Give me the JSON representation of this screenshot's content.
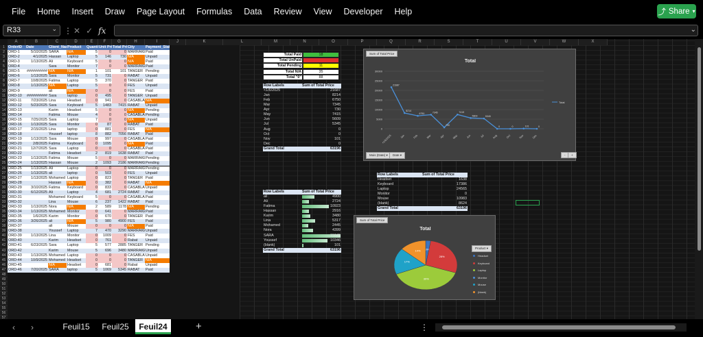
{
  "menu": [
    "File",
    "Home",
    "Insert",
    "Draw",
    "Page Layout",
    "Formulas",
    "Data",
    "Review",
    "View",
    "Developer",
    "Help"
  ],
  "share_label": "Share",
  "namebox": "R33",
  "columns": [
    "A",
    "B",
    "C",
    "D",
    "E",
    "F",
    "G",
    "H",
    "I",
    "J",
    "K",
    "L",
    "M",
    "N",
    "O",
    "P",
    "Q",
    "R",
    "S",
    "T",
    "U",
    "V",
    "W",
    "X"
  ],
  "headers": [
    "OrderID",
    "Date",
    "Client_Name",
    "Product",
    "Quantity",
    "Unit Price",
    "Total Price",
    "City",
    "Payment_Status"
  ],
  "rows": [
    [
      "ORD-1",
      "5/10/2025",
      "SARA",
      "N/A",
      "5",
      "0",
      "0",
      "MARRAKECH",
      "Paid"
    ],
    [
      "ORD-2",
      "4/1/2025",
      "Hassan",
      "Laptop",
      "5",
      "146",
      "730",
      "N/A",
      "Unpaid"
    ],
    [
      "ORD-3",
      "1/13/2025",
      "Ali",
      "Keyboard",
      "5",
      "0",
      "0",
      "N/A",
      "Paid"
    ],
    [
      "ORD-4",
      "",
      "Sara",
      "Monitor",
      "7",
      "0",
      "0",
      "MARRAKECH",
      "Paid"
    ],
    [
      "ORD-5",
      "##########",
      "N/A",
      "N/A",
      "1",
      "101",
      "101",
      "TANGER",
      "Pending"
    ],
    [
      "ORD-6",
      "1/13/2025",
      "Sara",
      "Monitor",
      "5",
      "731",
      "0",
      "RABAT",
      "Unpaid"
    ],
    [
      "ORD-7",
      "10/8/2025",
      "Fatima",
      "Laptop",
      "5",
      "370",
      "0",
      "TANGER",
      "Paid"
    ],
    [
      "ORD-8",
      "1/13/2025",
      "N/A",
      "Laptop",
      "5",
      "0",
      "0",
      "FES",
      "Unpaid"
    ],
    [
      "ORD-9",
      "",
      "ali",
      "N/A",
      "0",
      "0",
      "0",
      "FES",
      "Paid"
    ],
    [
      "ORD-10",
      "##########",
      "Sara",
      "laptop",
      "0",
      "495",
      "0",
      "TANGER",
      "Unpaid"
    ],
    [
      "ORD-11",
      "7/23/2025",
      "Lina",
      "Headset",
      "0",
      "941",
      "0",
      "CASABLANCA",
      "N/A"
    ],
    [
      "ORD-12",
      "5/23/2025",
      "Sara",
      "Keyboard",
      "5",
      "1483",
      "7415",
      "RABAT",
      "Unpaid"
    ],
    [
      "ORD-13",
      "",
      "Karim",
      "Headset",
      "5",
      "0",
      "0",
      "N/A",
      "Pending"
    ],
    [
      "ORD-14",
      "",
      "Fatima",
      "Mouse",
      "4",
      "0",
      "0",
      "CASABLANCA",
      "Pending"
    ],
    [
      "ORD-15",
      "7/25/2025",
      "Sara",
      "Laptop",
      "7",
      "0",
      "0",
      "N/A",
      "Unpaid"
    ],
    [
      "ORD-16",
      "1/13/2025",
      "Sara",
      "Monitor",
      "0",
      "87",
      "0",
      "RABAT",
      "Paid"
    ],
    [
      "ORD-17",
      "2/15/2025",
      "Lina",
      "laptop",
      "0",
      "881",
      "0",
      "FES",
      "N/A"
    ],
    [
      "ORD-18",
      "",
      "Youssef",
      "laptop",
      "8",
      "882",
      "7056",
      "RABAT",
      "Paid"
    ],
    [
      "ORD-19",
      "1/13/2025",
      "Sara",
      "Mouse",
      "0",
      "997",
      "0",
      "CASABLANCA",
      "Paid"
    ],
    [
      "ORD-20",
      "2/8/2025",
      "Fatima",
      "Keyboard",
      "0",
      "1095",
      "0",
      "N/A",
      "Paid"
    ],
    [
      "ORD-21",
      "12/7/2025",
      "Sara",
      "Laptop",
      "0",
      "0",
      "0",
      "CASABLANCA",
      "Paid"
    ],
    [
      "ORD-22",
      "",
      "Fatima",
      "Headset",
      "2",
      "819",
      "1638",
      "RABAT",
      "Paid"
    ],
    [
      "ORD-23",
      "1/13/2025",
      "Fatima",
      "Mouse",
      "5",
      "0",
      "0",
      "MARRAKECH",
      "Pending"
    ],
    [
      "ORD-24",
      "1/13/2025",
      "Hassan",
      "Mouse",
      "2",
      "1093",
      "2186",
      "MARRAKECH",
      "Pending"
    ],
    [
      "ORD-25",
      "1/13/2025",
      "Ali",
      "Laptop",
      "0",
      "0",
      "0",
      "MARRAKECH",
      "Pending"
    ],
    [
      "ORD-26",
      "1/13/2025",
      "ali",
      "laptop",
      "0",
      "503",
      "0",
      "FES",
      "Unpaid"
    ],
    [
      "ORD-27",
      "1/13/2025",
      "Mohamed",
      "Laptop",
      "0",
      "823",
      "0",
      "TANGER",
      "Paid"
    ],
    [
      "ORD-28",
      "",
      "Hassan",
      "N/A",
      "0",
      "382",
      "0",
      "RABAT",
      "N/A"
    ],
    [
      "ORD-29",
      "3/10/2025",
      "Fatima",
      "Keyboard",
      "0",
      "833",
      "0",
      "CASABLANCA",
      "Unpaid"
    ],
    [
      "ORD-30",
      "6/12/2025",
      "Ali",
      "Laptop",
      "4",
      "681",
      "2724",
      "RABAT",
      "Paid"
    ],
    [
      "ORD-31",
      "",
      "Mohamed",
      "Keyboard",
      "5",
      "0",
      "0",
      "CASABLANCA",
      "Paid"
    ],
    [
      "ORD-32",
      "",
      "Lina",
      "Mouse",
      "6",
      "237",
      "1422",
      "RABAT",
      "Paid"
    ],
    [
      "ORD-33",
      "1/13/2025",
      "Nora",
      "N/A",
      "2",
      "589",
      "1178",
      "N/A",
      "Pending"
    ],
    [
      "ORD-34",
      "1/13/2025",
      "Mohamed",
      "Monitor",
      "0",
      "641",
      "0",
      "MARRAKECH",
      "Paid"
    ],
    [
      "ORD-35",
      "1/6/2025",
      "Karim",
      "Monitor",
      "0",
      "670",
      "0",
      "TANGER",
      "Paid"
    ],
    [
      "ORD-36",
      "3/26/2025",
      "ali",
      "N/A",
      "5",
      "980",
      "4900",
      "FES",
      "Paid"
    ],
    [
      "ORD-37",
      "",
      "ali",
      "Mouse",
      "0",
      "0",
      "0",
      "N/A",
      "Paid"
    ],
    [
      "ORD-38",
      "",
      "Youssef",
      "Laptop",
      "7",
      "470",
      "3290",
      "MARRAKECH",
      "Unpaid"
    ],
    [
      "ORD-39",
      "1/13/2025",
      "Lina",
      "Monitor",
      "0",
      "1009",
      "0",
      "FES",
      "Paid"
    ],
    [
      "ORD-40",
      "",
      "Karim",
      "Headset",
      "0",
      "761",
      "0",
      "Rabat",
      "Unpaid"
    ],
    [
      "ORD-41",
      "6/23/2025",
      "Sara",
      "Laptop",
      "5",
      "577",
      "2885",
      "TANGER",
      "Pending"
    ],
    [
      "ORD-42",
      "",
      "Karim",
      "Mouse",
      "5",
      "696",
      "3480",
      "MARRAKECH",
      "Unpaid"
    ],
    [
      "ORD-43",
      "1/13/2025",
      "Mohamed",
      "Laptop",
      "0",
      "0",
      "0",
      "CASABLANCA",
      "Unpaid"
    ],
    [
      "ORD-44",
      "10/9/2025",
      "Mohamed",
      "Headset",
      "0",
      "0",
      "0",
      "TANGER",
      "N/A"
    ],
    [
      "ORD-45",
      "",
      "N/A",
      "Headset",
      "0",
      "681",
      "0",
      "Rabat",
      "Unpaid"
    ],
    [
      "ORD-46",
      "7/20/2025",
      "SARA",
      "laptop",
      "5",
      "1069",
      "5345",
      "RABAT",
      "Paid"
    ]
  ],
  "summary": [
    {
      "label": "Total Paid",
      "value": "18"
    },
    {
      "label": "Total UnPaid",
      "value": ""
    },
    {
      "label": "Total Pending",
      "value": "11"
    },
    {
      "label": "Total N/A",
      "value": "35"
    },
    {
      "label": "Total \"0\"",
      "value": "88"
    }
  ],
  "pivot_month": {
    "hdr_a": "Row Labels",
    "hdr_b": "Sum of Total Price",
    "rows": [
      [
        "<1/6/2025",
        "21687"
      ],
      [
        "Jan",
        "8214"
      ],
      [
        "Feb",
        "6750"
      ],
      [
        "Mar",
        "7345"
      ],
      [
        "Apr",
        "730"
      ],
      [
        "May",
        "7415"
      ],
      [
        "Jun",
        "5609"
      ],
      [
        "Jul",
        "5345"
      ],
      [
        "Aug",
        "0"
      ],
      [
        "Oct",
        "0"
      ],
      [
        "Nov",
        "101"
      ],
      [
        "Dec",
        "0"
      ]
    ],
    "total_label": "Grand Total",
    "total_value": "63196"
  },
  "pivot_client": {
    "hdr_a": "Row Labels",
    "hdr_b": "Sum of Total Price",
    "rows": [
      [
        "ali",
        "4900"
      ],
      [
        "Ali",
        "2724"
      ],
      [
        "Fatima",
        "10923"
      ],
      [
        "Hassan",
        "2916"
      ],
      [
        "Karim",
        "3480"
      ],
      [
        "Lina",
        "5317"
      ],
      [
        "Mohamed",
        "2445"
      ],
      [
        "Nora",
        "4399"
      ],
      [
        "SARA",
        "15645"
      ],
      [
        "Youssef",
        "10346"
      ],
      [
        "(blank)",
        "101"
      ]
    ],
    "total_label": "Grand Total",
    "total_value": "63196"
  },
  "pivot_product": {
    "hdr_a": "Row Labels",
    "hdr_b": "Sum of Total Price",
    "rows": [
      [
        "Headset",
        "1638"
      ],
      [
        "Keyboard",
        "17386"
      ],
      [
        "Laptop",
        "24565"
      ],
      [
        "Monitor",
        "0"
      ],
      [
        "Mouse",
        "10983"
      ],
      [
        "(blank)",
        "8624"
      ]
    ],
    "total_label": "Grand Total",
    "total_value": "63196"
  },
  "line_chart": {
    "tab": "Sum of Total Price",
    "title": "Total",
    "legend": "Total",
    "filters": [
      "Mois (Date)",
      "Date"
    ],
    "yticks": [
      "30000",
      "25000",
      "20000",
      "15000",
      "10000",
      "5000",
      "0"
    ]
  },
  "pie_chart": {
    "tab": "Sum of Total Price",
    "title": "Total",
    "filter": "Product",
    "legend": [
      "Headset",
      "Keyboard",
      "Laptop",
      "Monitor",
      "Mouse",
      "(blank)"
    ],
    "labels": [
      "3%",
      "27%",
      "39%",
      "17%",
      "14%"
    ]
  },
  "chart_data": [
    {
      "type": "line",
      "title": "Total",
      "categories": [
        "<1/6/2025",
        "Jan",
        "Feb",
        "Mar",
        "Apr",
        "May",
        "Jun",
        "Jul",
        "Aug",
        "Oct",
        "Nov",
        "Dec"
      ],
      "series": [
        {
          "name": "Total",
          "values": [
            21687,
            8214,
            6750,
            7345,
            730,
            7415,
            5609,
            5345,
            0,
            0,
            101,
            0
          ]
        }
      ],
      "ylim": [
        0,
        30000
      ],
      "grid": true,
      "legend": "right",
      "color": "#4a90d9"
    },
    {
      "type": "pie",
      "title": "Total",
      "categories": [
        "Headset",
        "Keyboard",
        "Laptop",
        "Monitor",
        "Mouse",
        "(blank)"
      ],
      "values": [
        1638,
        17386,
        24565,
        0,
        10983,
        8624
      ],
      "colors": [
        "#3b74c4",
        "#d33b3b",
        "#9ccb3b",
        "#4a90d9",
        "#1fa2c8",
        "#f0922b"
      ],
      "legend": "right"
    }
  ],
  "sheets": [
    "Feuil15",
    "Feuil25",
    "Feuil24"
  ],
  "active_sheet": "Feuil24",
  "colors": {
    "accent": "#2aa24e",
    "header_blue": "#4e78b8",
    "row_band": "#dbe5f3",
    "na_orange": "#f57c00",
    "zero_pink": "#f4c7c7"
  }
}
